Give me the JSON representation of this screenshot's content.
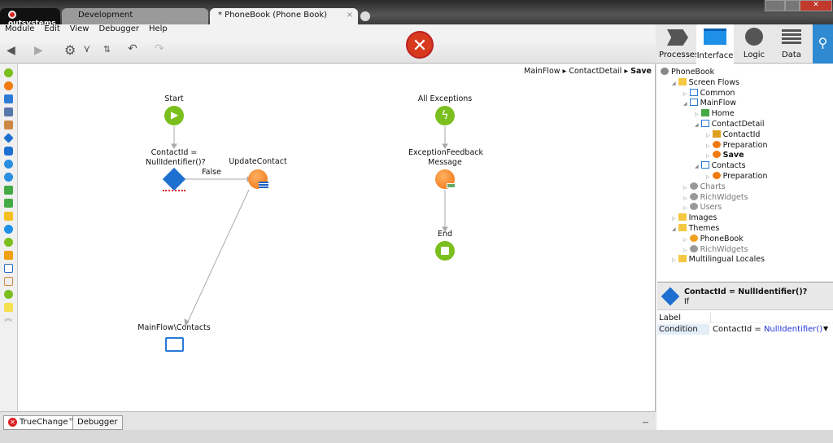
{
  "titlebar": {
    "brand": "outsystems",
    "tabs": [
      {
        "label": "Development"
      },
      {
        "label": "* PhoneBook (Phone Book)"
      }
    ],
    "close_tab": "×"
  },
  "menu": [
    "Module",
    "Edit",
    "View",
    "Debugger",
    "Help"
  ],
  "toolbar": {
    "error_icon": "error-x-icon"
  },
  "right_tabs": [
    {
      "label": "Processes"
    },
    {
      "label": "Interface"
    },
    {
      "label": "Logic"
    },
    {
      "label": "Data"
    }
  ],
  "breadcrumb": [
    "MainFlow",
    "ContactDetail",
    "Save"
  ],
  "flow": {
    "start": "Start",
    "if_label": "ContactId = NullIdentifier()?",
    "false_label": "False",
    "update": "UpdateContact",
    "destination": "MainFlow\\Contacts",
    "all_exceptions": "All Exceptions",
    "exception_feedback": "ExceptionFeedback Message",
    "end": "End"
  },
  "tree": [
    {
      "label": "PhoneBook",
      "level": 0,
      "icon": "module"
    },
    {
      "label": "Screen Flows",
      "level": 1,
      "icon": "folder"
    },
    {
      "label": "Common",
      "level": 2,
      "icon": "flow"
    },
    {
      "label": "MainFlow",
      "level": 2,
      "icon": "flow"
    },
    {
      "label": "Home",
      "level": 3,
      "icon": "home-screen"
    },
    {
      "label": "ContactDetail",
      "level": 3,
      "icon": "screen"
    },
    {
      "label": "ContactId",
      "level": 4,
      "icon": "input"
    },
    {
      "label": "Preparation",
      "level": 4,
      "icon": "preparation"
    },
    {
      "label": "Save",
      "level": 4,
      "icon": "action",
      "bold": true
    },
    {
      "label": "Contacts",
      "level": 3,
      "icon": "screen"
    },
    {
      "label": "Preparation",
      "level": 4,
      "icon": "preparation"
    },
    {
      "label": "Charts",
      "level": 2,
      "icon": "ref",
      "grey": true
    },
    {
      "label": "RichWidgets",
      "level": 2,
      "icon": "ref",
      "grey": true
    },
    {
      "label": "Users",
      "level": 2,
      "icon": "ref",
      "grey": true
    },
    {
      "label": "Images",
      "level": 1,
      "icon": "folder"
    },
    {
      "label": "Themes",
      "level": 1,
      "icon": "folder"
    },
    {
      "label": "PhoneBook",
      "level": 2,
      "icon": "theme"
    },
    {
      "label": "RichWidgets",
      "level": 2,
      "icon": "ref",
      "grey": true
    },
    {
      "label": "Multilingual Locales",
      "level": 1,
      "icon": "folder"
    }
  ],
  "props": {
    "title": "ContactId = NullIdentifier()?",
    "type": "If",
    "rows": [
      {
        "name": "Label",
        "value": ""
      },
      {
        "name": "Condition",
        "value_prefix": "ContactId = ",
        "value_fn": "NullIdentifier()"
      }
    ]
  },
  "bottom_tabs": [
    {
      "label": "TrueChange™"
    },
    {
      "label": "Debugger"
    }
  ]
}
